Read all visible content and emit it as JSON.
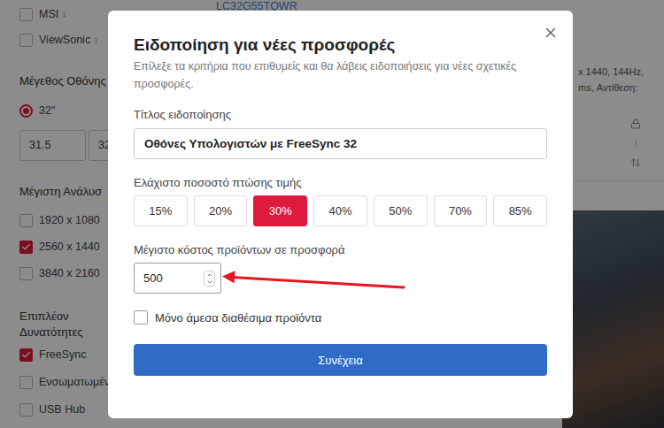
{
  "page": {
    "brands": [
      {
        "label": "MSI",
        "count": "1",
        "checked": false
      },
      {
        "label": "ViewSonic",
        "count": "1",
        "checked": false
      }
    ],
    "screen_size": {
      "heading": "Μέγεθος Οθόνης",
      "options": [
        {
          "label": "32\"",
          "selected": true
        }
      ],
      "range": [
        "31.5",
        "32"
      ]
    },
    "resolution": {
      "heading": "Μέγιστη Ανάλυσ",
      "items": [
        {
          "label": "1920 x 1080",
          "checked": false
        },
        {
          "label": "2560 x 1440",
          "checked": true
        },
        {
          "label": "3840 x 2160",
          "checked": false
        }
      ]
    },
    "features": {
      "heading": "Επιπλέον Δυνατότητες",
      "items": [
        {
          "label": "FreeSync",
          "checked": true
        },
        {
          "label": "Ενσωματωμέν",
          "checked": false
        },
        {
          "label": "USB Hub",
          "checked": false
        }
      ]
    },
    "product": {
      "code": "LC32G55TQWR",
      "specs": [
        "x 1440, 144Hz,",
        "ms, Αντίθεση:"
      ]
    }
  },
  "dialog": {
    "title": "Ειδοποίηση για νέες προσφορές",
    "subtitle": "Επίλεξε τα κριτήρια που επιθυμείς και θα λάβεις ειδοποιήσεις για νέες σχετικές προσφορές.",
    "name_field": {
      "label": "Τίτλος ειδοποίησης",
      "value": "Οθόνες Υπολογιστών με FreeSync 32"
    },
    "price_drop": {
      "label": "Ελάχιστο ποσοστό πτώσης τιμής",
      "options": [
        {
          "label": "15%",
          "selected": false
        },
        {
          "label": "20%",
          "selected": false
        },
        {
          "label": "30%",
          "selected": true
        },
        {
          "label": "40%",
          "selected": false
        },
        {
          "label": "50%",
          "selected": false
        },
        {
          "label": "70%",
          "selected": false
        },
        {
          "label": "85%",
          "selected": false
        }
      ]
    },
    "max_cost": {
      "label": "Μέγιστο κόστος προϊόντων σε προσφορά",
      "value": "500"
    },
    "in_stock": {
      "label": "Μόνο άμεσα διαθέσιμα προϊόντα",
      "checked": false
    },
    "submit": "Συνέχεια"
  }
}
